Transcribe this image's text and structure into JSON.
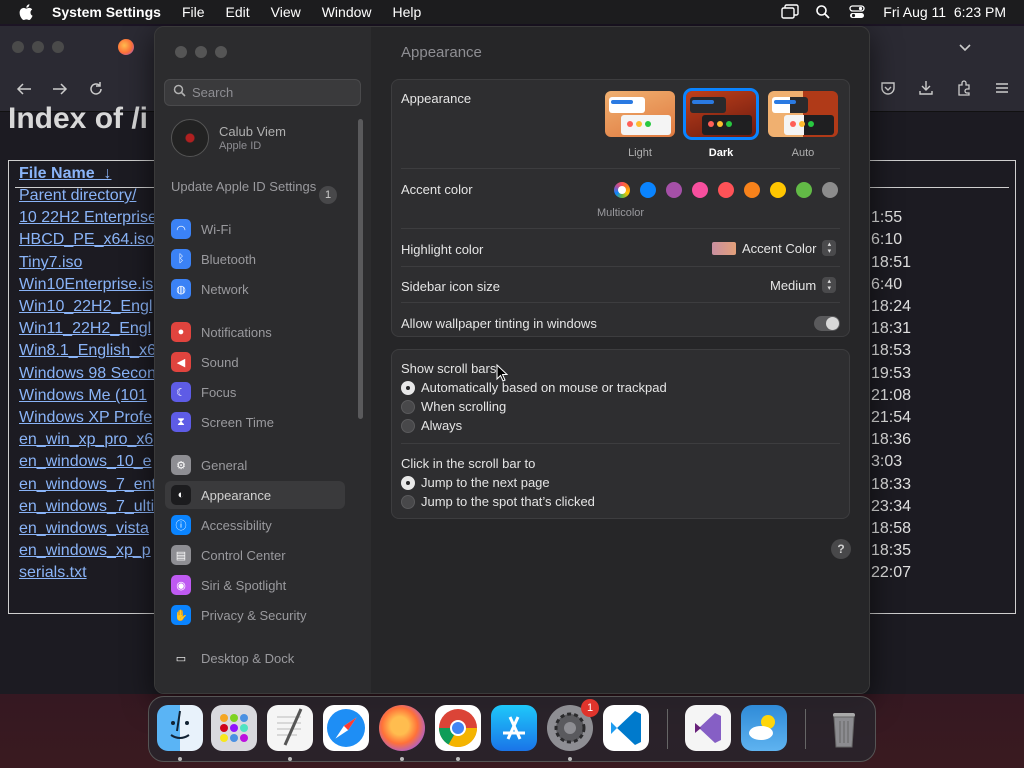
{
  "menubar": {
    "app_name": "System Settings",
    "items": [
      "File",
      "Edit",
      "View",
      "Window",
      "Help"
    ],
    "clock": "Fri Aug 11  6:23 PM"
  },
  "browser": {
    "page_heading": "Index of /i",
    "header_file_name": "File Name  ↓",
    "files": [
      "Parent directory/",
      "10 22H2 Enterprise",
      "HBCD_PE_x64.iso",
      "Tiny7.iso",
      "Win10Enterprise.is",
      "Win10_22H2_Engl",
      "Win11_22H2_Engl",
      "Win8.1_English_x6",
      "Windows 98 Secon",
      "Windows Me (101",
      "Windows XP Profe",
      "en_win_xp_pro_x6",
      "en_windows_10_e",
      "en_windows_7_ent",
      "en_windows_7_ulti",
      "en_windows_vista",
      "en_windows_xp_p",
      "serials.txt"
    ],
    "times": [
      "1:55",
      "6:10",
      "18:51",
      "6:40",
      "18:24",
      "18:31",
      "18:53",
      "19:53",
      "21:08",
      "21:54",
      "18:36",
      "3:03",
      "18:33",
      "23:34",
      "18:58",
      "18:35",
      "22:07"
    ]
  },
  "sidebar": {
    "search_placeholder": "Search",
    "user_name": "Calub Viem",
    "user_sub": "Apple ID",
    "update_label": "Update Apple ID Settings",
    "update_count": "1",
    "items": [
      {
        "label": "Wi-Fi",
        "icon": "wifi-icon",
        "color": "#3b82f6"
      },
      {
        "label": "Bluetooth",
        "icon": "bluetooth-icon",
        "color": "#3b82f6"
      },
      {
        "label": "Network",
        "icon": "network-icon",
        "color": "#3b82f6"
      },
      {
        "label": "Notifications",
        "icon": "bell-icon",
        "color": "#e0443e"
      },
      {
        "label": "Sound",
        "icon": "speaker-icon",
        "color": "#e0443e"
      },
      {
        "label": "Focus",
        "icon": "moon-icon",
        "color": "#5e5ce6"
      },
      {
        "label": "Screen Time",
        "icon": "hourglass-icon",
        "color": "#5e5ce6"
      },
      {
        "label": "General",
        "icon": "gear-icon",
        "color": "#8e8e93"
      },
      {
        "label": "Appearance",
        "icon": "appearance-icon",
        "color": "#1c1c1e"
      },
      {
        "label": "Accessibility",
        "icon": "accessibility-icon",
        "color": "#0a84ff"
      },
      {
        "label": "Control Center",
        "icon": "control-center-icon",
        "color": "#8e8e93"
      },
      {
        "label": "Siri & Spotlight",
        "icon": "siri-icon",
        "color": "#bf5af2"
      },
      {
        "label": "Privacy & Security",
        "icon": "hand-icon",
        "color": "#0a84ff"
      },
      {
        "label": "Desktop & Dock",
        "icon": "dock-icon",
        "color": "#2c2c2e"
      }
    ]
  },
  "main": {
    "title": "Appearance",
    "appearance_label": "Appearance",
    "themes": [
      "Light",
      "Dark",
      "Auto"
    ],
    "selected_theme": "Dark",
    "accent_label": "Accent color",
    "accent_colors": [
      "multicolor",
      "#0a84ff",
      "#a550a7",
      "#f74f9e",
      "#ff5257",
      "#f7821b",
      "#ffc600",
      "#62ba46",
      "#8c8c8c"
    ],
    "multicolor_label": "Multicolor",
    "highlight_label": "Highlight color",
    "highlight_value": "Accent Color",
    "sidebar_icon_label": "Sidebar icon size",
    "sidebar_icon_value": "Medium",
    "wallpaper_tint_label": "Allow wallpaper tinting in windows",
    "scroll_label": "Show scroll bars",
    "scroll_options": [
      "Automatically based on mouse or trackpad",
      "When scrolling",
      "Always"
    ],
    "click_label": "Click in the scroll bar to",
    "click_options": [
      "Jump to the next page",
      "Jump to the spot that’s clicked"
    ],
    "help": "?"
  },
  "dock": {
    "apps": [
      "Finder",
      "Launchpad",
      "TextEdit",
      "Safari",
      "Firefox",
      "Chrome",
      "App Store",
      "System Settings",
      "Visual Studio Code",
      "Visual Studio",
      "Weather",
      "Trash"
    ],
    "settings_badge": "1"
  }
}
